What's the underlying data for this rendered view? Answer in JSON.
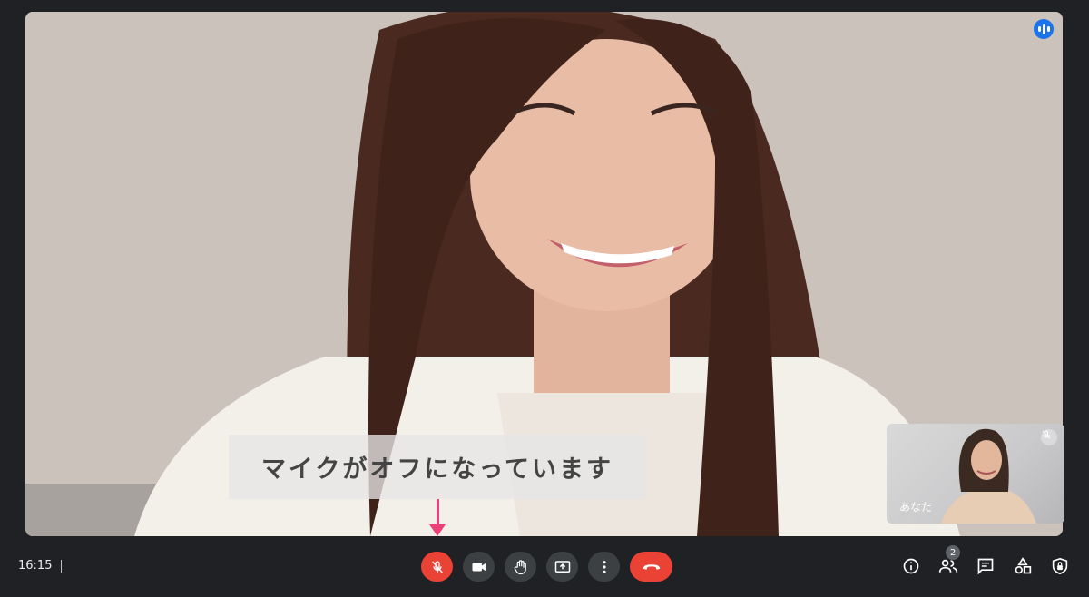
{
  "meeting": {
    "caption_text": "マイクがオフになっています",
    "self_label": "あなた",
    "time": "16:15",
    "participant_count": "2"
  },
  "colors": {
    "background": "#202124",
    "button_dark": "#3c4043",
    "button_red": "#ea4335",
    "speaking_blue": "#1a73e8",
    "arrow_pink": "#ec407a"
  },
  "icons": {
    "mic": "mic-off-icon",
    "camera": "videocam-icon",
    "hand": "raise-hand-icon",
    "present": "present-screen-icon",
    "more": "more-vert-icon",
    "hangup": "call-end-icon",
    "info": "info-icon",
    "people": "people-icon",
    "chat": "chat-icon",
    "activities": "activities-icon",
    "lock": "host-controls-icon"
  }
}
